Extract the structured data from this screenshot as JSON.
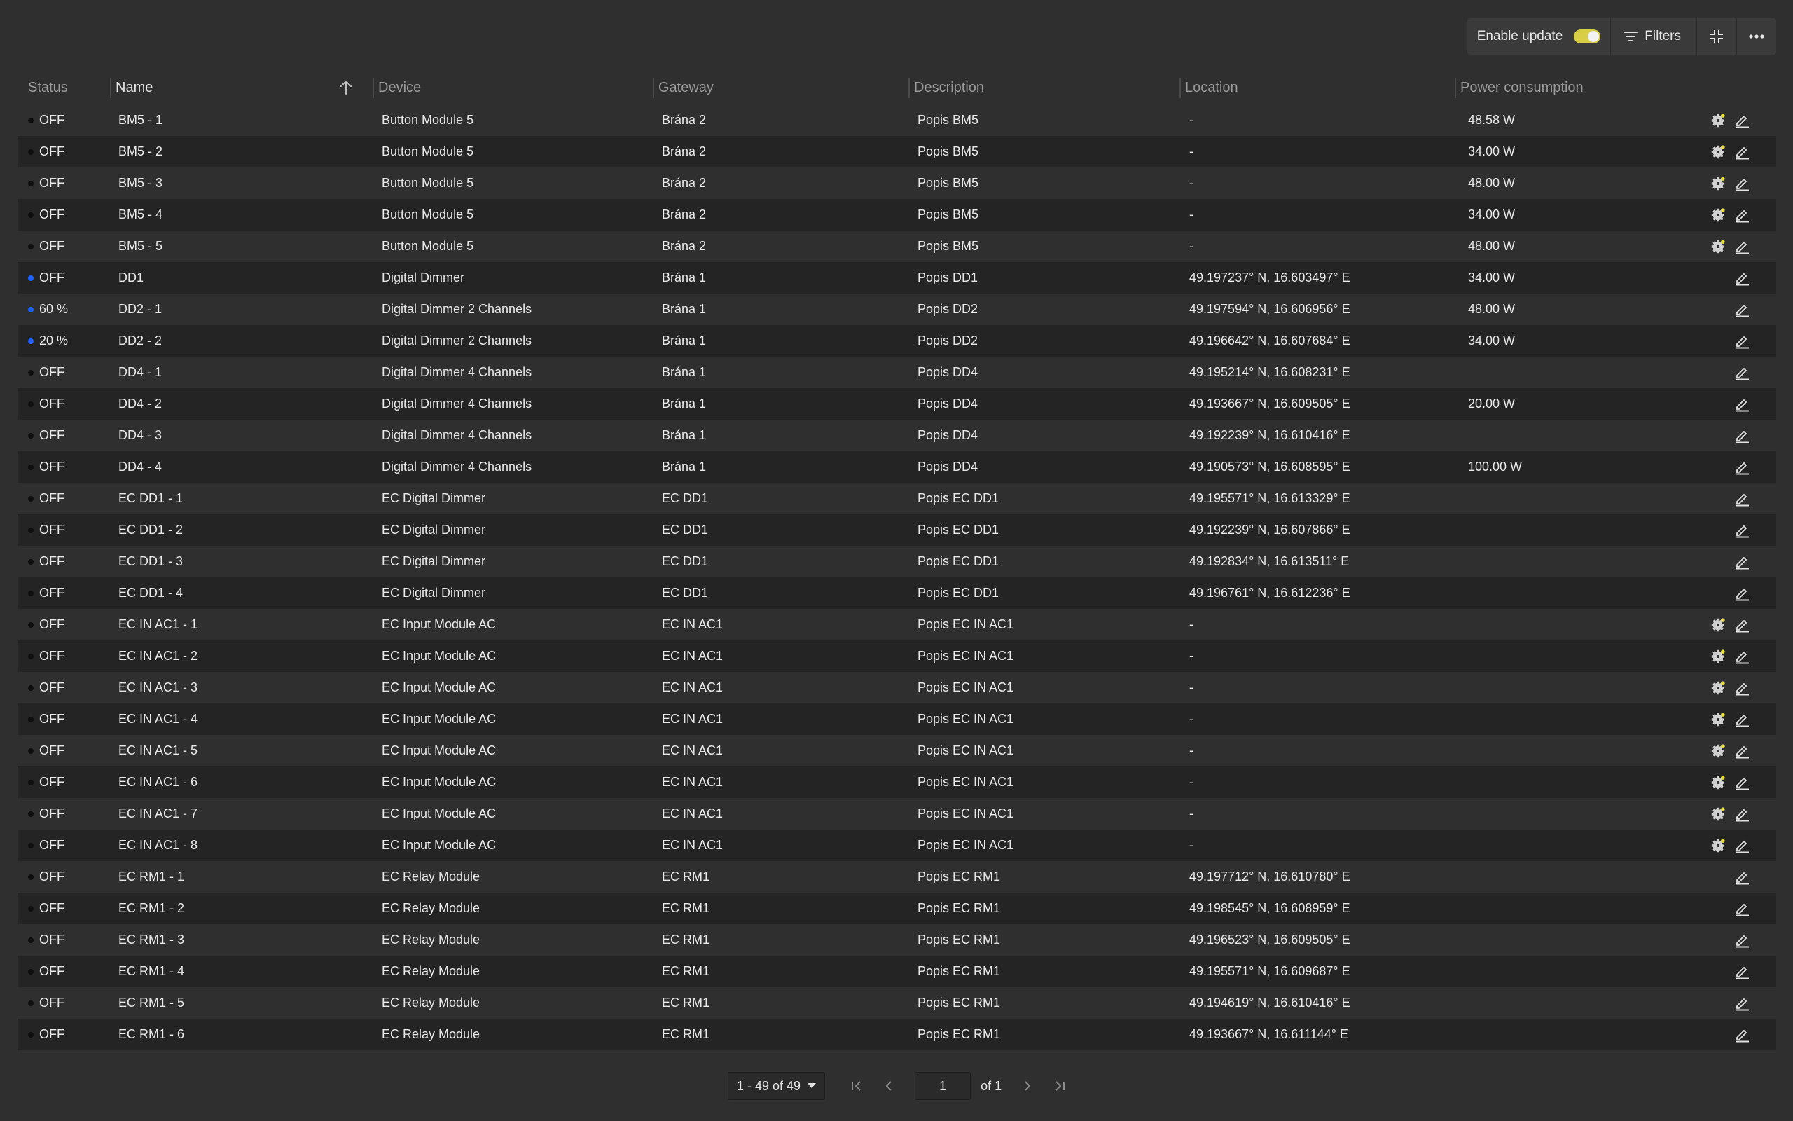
{
  "toolbar": {
    "enable_update_label": "Enable update",
    "enable_update_on": true,
    "filters_label": "Filters"
  },
  "columns": [
    "Status",
    "Name",
    "Device",
    "Gateway",
    "Description",
    "Location",
    "Power consumption"
  ],
  "sort": {
    "column": "Name",
    "direction": "ascending"
  },
  "colors": {
    "accent_toggle": "#d8cf46",
    "status_on": "#1f60ff",
    "status_off": "#0e0e0e"
  },
  "rows": [
    {
      "on": false,
      "status": "OFF",
      "name": "BM5 - 1",
      "device": "Button Module 5",
      "gateway": "Brána 2",
      "description": "Popis BM5",
      "location": "-",
      "power": "48.58 W",
      "gear": true
    },
    {
      "on": false,
      "status": "OFF",
      "name": "BM5 - 2",
      "device": "Button Module 5",
      "gateway": "Brána 2",
      "description": "Popis BM5",
      "location": "-",
      "power": "34.00 W",
      "gear": true
    },
    {
      "on": false,
      "status": "OFF",
      "name": "BM5 - 3",
      "device": "Button Module 5",
      "gateway": "Brána 2",
      "description": "Popis BM5",
      "location": "-",
      "power": "48.00 W",
      "gear": true
    },
    {
      "on": false,
      "status": "OFF",
      "name": "BM5 - 4",
      "device": "Button Module 5",
      "gateway": "Brána 2",
      "description": "Popis BM5",
      "location": "-",
      "power": "34.00 W",
      "gear": true
    },
    {
      "on": false,
      "status": "OFF",
      "name": "BM5 - 5",
      "device": "Button Module 5",
      "gateway": "Brána 2",
      "description": "Popis BM5",
      "location": "-",
      "power": "48.00 W",
      "gear": true
    },
    {
      "on": true,
      "status": "OFF",
      "name": "DD1",
      "device": "Digital Dimmer",
      "gateway": "Brána 1",
      "description": "Popis DD1",
      "location": "49.197237° N, 16.603497° E",
      "power": "34.00 W",
      "gear": false
    },
    {
      "on": true,
      "status": "60 %",
      "name": "DD2 - 1",
      "device": "Digital Dimmer 2 Channels",
      "gateway": "Brána 1",
      "description": "Popis DD2",
      "location": "49.197594° N, 16.606956° E",
      "power": "48.00 W",
      "gear": false
    },
    {
      "on": true,
      "status": "20 %",
      "name": "DD2 - 2",
      "device": "Digital Dimmer 2 Channels",
      "gateway": "Brána 1",
      "description": "Popis DD2",
      "location": "49.196642° N, 16.607684° E",
      "power": "34.00 W",
      "gear": false
    },
    {
      "on": false,
      "status": "OFF",
      "name": "DD4 - 1",
      "device": "Digital Dimmer 4 Channels",
      "gateway": "Brána 1",
      "description": "Popis DD4",
      "location": "49.195214° N, 16.608231° E",
      "power": "",
      "gear": false
    },
    {
      "on": false,
      "status": "OFF",
      "name": "DD4 - 2",
      "device": "Digital Dimmer 4 Channels",
      "gateway": "Brána 1",
      "description": "Popis DD4",
      "location": "49.193667° N, 16.609505° E",
      "power": "20.00 W",
      "gear": false
    },
    {
      "on": false,
      "status": "OFF",
      "name": "DD4 - 3",
      "device": "Digital Dimmer 4 Channels",
      "gateway": "Brána 1",
      "description": "Popis DD4",
      "location": "49.192239° N, 16.610416° E",
      "power": "",
      "gear": false
    },
    {
      "on": false,
      "status": "OFF",
      "name": "DD4 - 4",
      "device": "Digital Dimmer 4 Channels",
      "gateway": "Brána 1",
      "description": "Popis DD4",
      "location": "49.190573° N, 16.608595° E",
      "power": "100.00 W",
      "gear": false
    },
    {
      "on": false,
      "status": "OFF",
      "name": "EC DD1 - 1",
      "device": "EC Digital Dimmer",
      "gateway": "EC DD1",
      "description": "Popis EC DD1",
      "location": "49.195571° N, 16.613329° E",
      "power": "",
      "gear": false
    },
    {
      "on": false,
      "status": "OFF",
      "name": "EC DD1 - 2",
      "device": "EC Digital Dimmer",
      "gateway": "EC DD1",
      "description": "Popis EC DD1",
      "location": "49.192239° N, 16.607866° E",
      "power": "",
      "gear": false
    },
    {
      "on": false,
      "status": "OFF",
      "name": "EC DD1 - 3",
      "device": "EC Digital Dimmer",
      "gateway": "EC DD1",
      "description": "Popis EC DD1",
      "location": "49.192834° N, 16.613511° E",
      "power": "",
      "gear": false
    },
    {
      "on": false,
      "status": "OFF",
      "name": "EC DD1 - 4",
      "device": "EC Digital Dimmer",
      "gateway": "EC DD1",
      "description": "Popis EC DD1",
      "location": "49.196761° N, 16.612236° E",
      "power": "",
      "gear": false
    },
    {
      "on": false,
      "status": "OFF",
      "name": "EC IN AC1 - 1",
      "device": "EC Input Module AC",
      "gateway": "EC IN AC1",
      "description": "Popis EC IN AC1",
      "location": "-",
      "power": "",
      "gear": true
    },
    {
      "on": false,
      "status": "OFF",
      "name": "EC IN AC1 - 2",
      "device": "EC Input Module AC",
      "gateway": "EC IN AC1",
      "description": "Popis EC IN AC1",
      "location": "-",
      "power": "",
      "gear": true
    },
    {
      "on": false,
      "status": "OFF",
      "name": "EC IN AC1 - 3",
      "device": "EC Input Module AC",
      "gateway": "EC IN AC1",
      "description": "Popis EC IN AC1",
      "location": "-",
      "power": "",
      "gear": true
    },
    {
      "on": false,
      "status": "OFF",
      "name": "EC IN AC1 - 4",
      "device": "EC Input Module AC",
      "gateway": "EC IN AC1",
      "description": "Popis EC IN AC1",
      "location": "-",
      "power": "",
      "gear": true
    },
    {
      "on": false,
      "status": "OFF",
      "name": "EC IN AC1 - 5",
      "device": "EC Input Module AC",
      "gateway": "EC IN AC1",
      "description": "Popis EC IN AC1",
      "location": "-",
      "power": "",
      "gear": true
    },
    {
      "on": false,
      "status": "OFF",
      "name": "EC IN AC1 - 6",
      "device": "EC Input Module AC",
      "gateway": "EC IN AC1",
      "description": "Popis EC IN AC1",
      "location": "-",
      "power": "",
      "gear": true
    },
    {
      "on": false,
      "status": "OFF",
      "name": "EC IN AC1 - 7",
      "device": "EC Input Module AC",
      "gateway": "EC IN AC1",
      "description": "Popis EC IN AC1",
      "location": "-",
      "power": "",
      "gear": true
    },
    {
      "on": false,
      "status": "OFF",
      "name": "EC IN AC1 - 8",
      "device": "EC Input Module AC",
      "gateway": "EC IN AC1",
      "description": "Popis EC IN AC1",
      "location": "-",
      "power": "",
      "gear": true
    },
    {
      "on": false,
      "status": "OFF",
      "name": "EC RM1 - 1",
      "device": "EC Relay Module",
      "gateway": "EC RM1",
      "description": "Popis EC RM1",
      "location": "49.197712° N, 16.610780° E",
      "power": "",
      "gear": false
    },
    {
      "on": false,
      "status": "OFF",
      "name": "EC RM1 - 2",
      "device": "EC Relay Module",
      "gateway": "EC RM1",
      "description": "Popis EC RM1",
      "location": "49.198545° N, 16.608959° E",
      "power": "",
      "gear": false
    },
    {
      "on": false,
      "status": "OFF",
      "name": "EC RM1 - 3",
      "device": "EC Relay Module",
      "gateway": "EC RM1",
      "description": "Popis EC RM1",
      "location": "49.196523° N, 16.609505° E",
      "power": "",
      "gear": false
    },
    {
      "on": false,
      "status": "OFF",
      "name": "EC RM1 - 4",
      "device": "EC Relay Module",
      "gateway": "EC RM1",
      "description": "Popis EC RM1",
      "location": "49.195571° N, 16.609687° E",
      "power": "",
      "gear": false
    },
    {
      "on": false,
      "status": "OFF",
      "name": "EC RM1 - 5",
      "device": "EC Relay Module",
      "gateway": "EC RM1",
      "description": "Popis EC RM1",
      "location": "49.194619° N, 16.610416° E",
      "power": "",
      "gear": false
    },
    {
      "on": false,
      "status": "OFF",
      "name": "EC RM1 - 6",
      "device": "EC Relay Module",
      "gateway": "EC RM1",
      "description": "Popis EC RM1",
      "location": "49.193667° N, 16.611144° E",
      "power": "",
      "gear": false
    }
  ],
  "pagination": {
    "range_label": "1 - 49 of 49",
    "page_value": "1",
    "of_label": "of 1"
  }
}
